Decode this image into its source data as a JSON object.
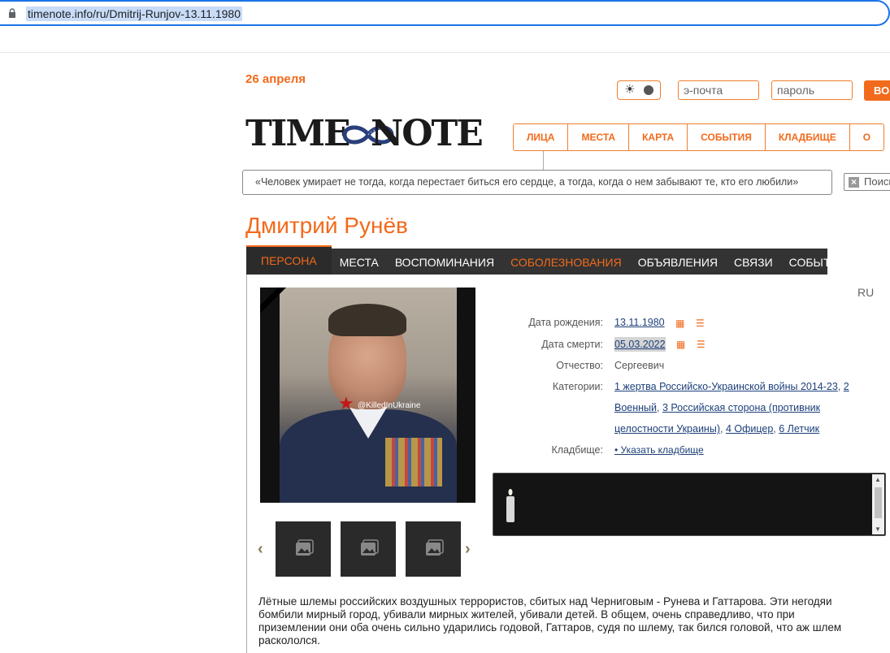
{
  "browser": {
    "url": "timenote.info/ru/Dmitrij-Runjov-13.11.1980"
  },
  "header": {
    "date": "26 апреля",
    "email_placeholder": "э-почта",
    "password_placeholder": "пароль",
    "login_label": "ВОЙТИ",
    "logo_left": "TIME",
    "logo_right": "NOTE"
  },
  "top_nav": [
    "ЛИЦА",
    "МЕСТА",
    "КАРТА",
    "СОБЫТИЯ",
    "КЛАДБИЩЕ",
    "О"
  ],
  "quote": "«Человек умирает не тогда, когда перестает биться его сердце, а тогда, когда о нем забывают те, кто его любили»",
  "search_placeholder": "Поиск",
  "person": {
    "name": "Дмитрий Рунёв",
    "photo_watermark": "@KilledInUkraine"
  },
  "tabs": [
    "ПЕРСОНА",
    "МЕСТА",
    "ВОСПОМИНАНИЯ",
    "СОБОЛЕЗНОВАНИЯ",
    "ОБЪЯВЛЕНИЯ",
    "СВЯЗИ",
    "СОБЫТИЯ"
  ],
  "lang": "RU",
  "fields": {
    "birth_label": "Дата рождения:",
    "birth_value": "13.11.1980",
    "death_label": "Дата смерти:",
    "death_value": "05.03.2022",
    "patronymic_label": "Отчество:",
    "patronymic_value": "Сергеевич",
    "categories_label": "Категории:",
    "categories": [
      "1 жертва Российско-Украинской войны 2014-23",
      "2 Военный",
      "3 Российская сторона (противник целостности Украины)",
      "4 Офицер",
      "6 Летчик"
    ],
    "cemetery_label": "Кладбище:",
    "cemetery_value": "• Указать кладбище"
  },
  "description": "Лётные шлемы российских воздушных террористов, сбитых над Черниговым - Рунева и Гаттарова. Эти негодяи бомбили мирный город, убивали мирных жителей, убивали детей. В общем, очень справедливо, что при приземлении они оба очень сильно ударились годовой, Гаттаров, судя по шлему, так бился головой, что аж шлем раскололся.",
  "colors": {
    "accent": "#f26a1b",
    "tabs_bg": "#333333",
    "link": "#1d3f7a"
  }
}
